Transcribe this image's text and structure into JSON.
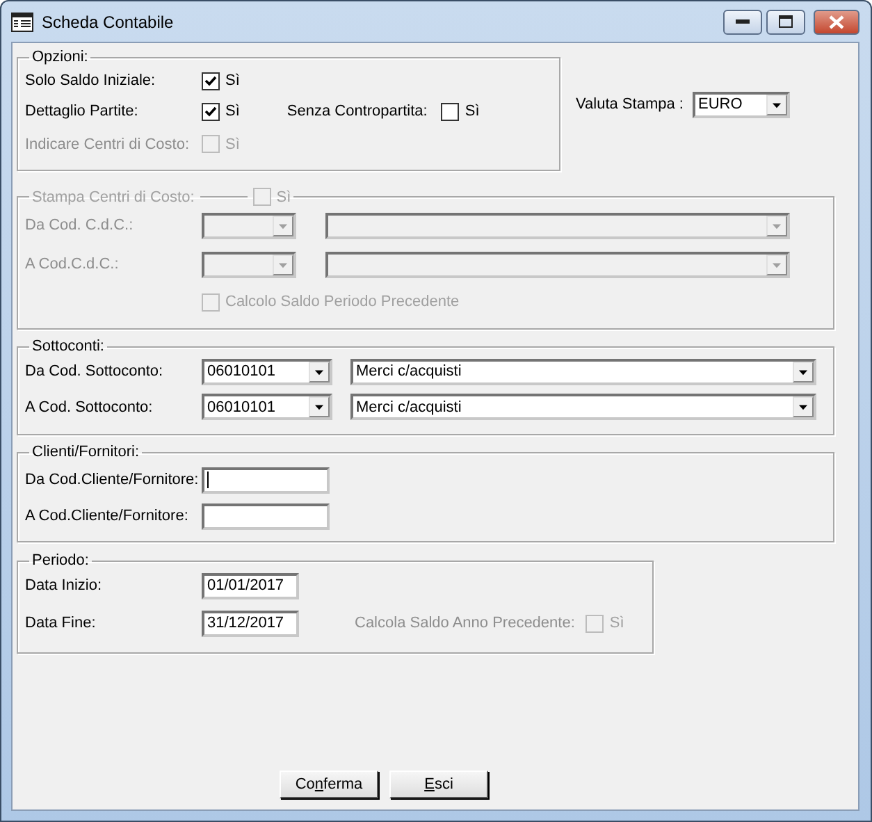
{
  "window": {
    "title": "Scheda Contabile"
  },
  "options": {
    "legend": "Opzioni:",
    "rows": [
      [
        {
          "label": "Solo Saldo Iniziale:",
          "check_label": "Sì",
          "checked": true,
          "disabled": false
        }
      ],
      [
        {
          "label": "Dettaglio Partite:",
          "check_label": "Sì",
          "checked": true,
          "disabled": false
        },
        {
          "label": "Senza Contropartita:",
          "check_label": "Sì",
          "checked": false,
          "disabled": false
        }
      ],
      [
        {
          "label": "Indicare Centri di Costo:",
          "check_label": "Sì",
          "checked": false,
          "disabled": true
        }
      ]
    ]
  },
  "currency": {
    "label": "Valuta Stampa :",
    "value": "EURO"
  },
  "cost_centers": {
    "legend": "Stampa Centri di Costo:",
    "check_label": "Sì",
    "checked": false,
    "disabled": true,
    "rows": [
      {
        "label": "Da Cod. C.d.C.:"
      },
      {
        "label": "A Cod.C.d.C.:"
      }
    ],
    "period_check": {
      "label": "Calcolo Saldo Periodo Precedente",
      "checked": false,
      "disabled": true
    }
  },
  "sub_accounts": {
    "legend": "Sottoconti:",
    "rows": [
      {
        "label": "Da Cod. Sottoconto:",
        "code": "06010101",
        "description": "Merci c/acquisti"
      },
      {
        "label": "A Cod. Sottoconto:",
        "code": "06010101",
        "description": "Merci c/acquisti"
      }
    ]
  },
  "customers": {
    "legend": "Clienti/Fornitori:",
    "rows": [
      {
        "label": "Da Cod.Cliente/Fornitore:",
        "focused": true
      },
      {
        "label": "A Cod.Cliente/Fornitore:",
        "focused": false
      }
    ]
  },
  "period": {
    "legend": "Periodo:",
    "rows": [
      {
        "label": "Data Inizio:",
        "value": "01/01/2017"
      },
      {
        "label": "Data Fine:",
        "value": "31/12/2017",
        "extra": {
          "label": "Calcola Saldo Anno Precedente:",
          "check_label": "Sì",
          "checked": false,
          "disabled": true
        }
      }
    ]
  },
  "buttons": [
    {
      "before": "Co",
      "underlined": "n",
      "after": "ferma"
    },
    {
      "underlined": "E",
      "after": "sci"
    }
  ]
}
